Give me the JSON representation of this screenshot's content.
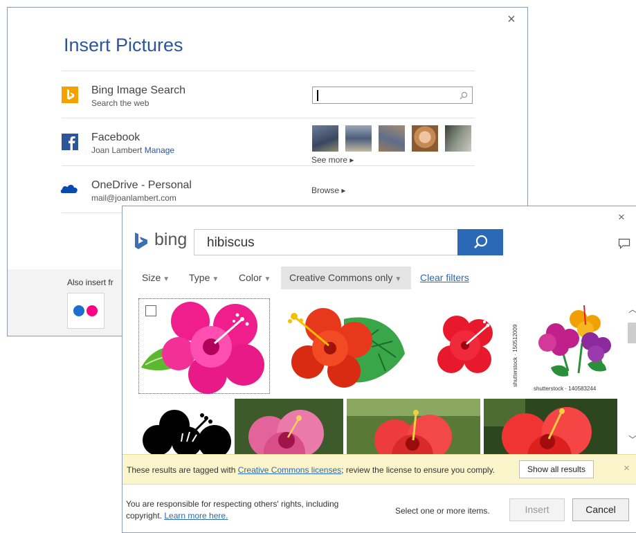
{
  "insert_pictures": {
    "title": "Insert Pictures",
    "close_glyph": "×",
    "sources": [
      {
        "name": "Bing Image Search",
        "sub": "Search the web",
        "icon": "bing-icon",
        "color": "#f5a100"
      },
      {
        "name": "Facebook",
        "sub": "Joan Lambert",
        "link": "Manage",
        "icon": "facebook-icon",
        "color": "#2b579a",
        "action": "See more ▸"
      },
      {
        "name": "OneDrive - Personal",
        "sub": "mail@joanlambert.com",
        "icon": "onedrive-icon",
        "color": "#094ab2",
        "action": "Browse ▸"
      }
    ],
    "search_placeholder": "",
    "also_insert": "Also insert fr",
    "flickr_colors": [
      "#1f6ecf",
      "#ff0084"
    ]
  },
  "bing_dialog": {
    "logo_text": "bing",
    "logo_color": "#2b68b5",
    "search_value": "hibiscus",
    "accent": "#2b68b5",
    "filters": [
      {
        "label": "Size"
      },
      {
        "label": "Type"
      },
      {
        "label": "Color"
      },
      {
        "label": "Creative Commons only"
      }
    ],
    "clear_filters": "Clear filters",
    "image_watermarks": [
      "shutterstock · 150512009",
      "shutterstock · 140583244"
    ],
    "notice": {
      "before": "These results are tagged with ",
      "link": "Creative Commons licenses",
      "after": "; review the license to ensure you comply.",
      "show_all": "Show all results",
      "close": "×"
    },
    "responsibility": {
      "text": "You are responsible for respecting others' rights, including copyright. ",
      "link": "Learn more here."
    },
    "select_message": "Select one or more items.",
    "insert_label": "Insert",
    "cancel_label": "Cancel",
    "close_glyph": "×"
  }
}
